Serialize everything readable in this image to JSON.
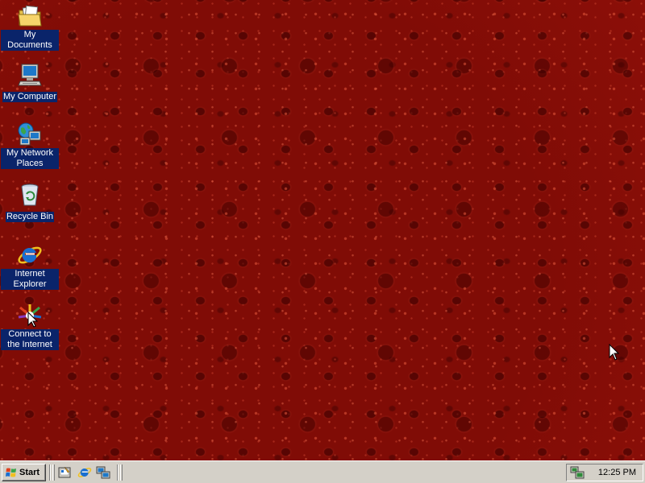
{
  "desktop": {
    "icons": [
      {
        "label": "My Documents",
        "icon": "folder-documents-icon"
      },
      {
        "label": "My Computer",
        "icon": "computer-icon"
      },
      {
        "label": "My Network Places",
        "icon": "network-places-icon"
      },
      {
        "label": "Recycle Bin",
        "icon": "recycle-bin-icon"
      },
      {
        "label": "Internet Explorer",
        "icon": "internet-explorer-icon"
      },
      {
        "label": "Connect to the Internet",
        "icon": "connect-internet-icon"
      }
    ],
    "wallpaper_color": "#8c0f08"
  },
  "taskbar": {
    "start_label": "Start",
    "quick_launch": [
      {
        "name": "show-desktop-icon"
      },
      {
        "name": "internet-explorer-icon"
      },
      {
        "name": "network-icon"
      }
    ],
    "tray": {
      "network_icon": "network-connection-icon",
      "clock": "12:25 PM"
    }
  }
}
